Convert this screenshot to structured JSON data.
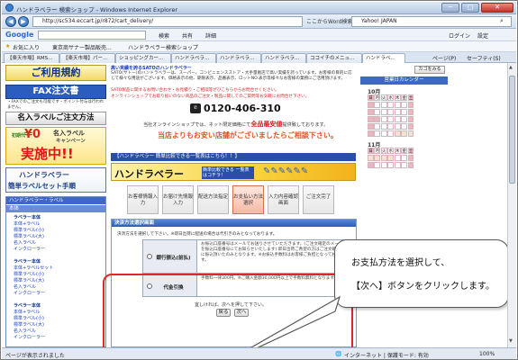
{
  "window": {
    "title": "ハンドラベラー 検索ショップ - Windows Internet Explorer",
    "minimize": "─",
    "maximize": "□",
    "close": "✕"
  },
  "addressbar": {
    "url": "http://sc534.eccart.jp/r872/cart_delivery/",
    "search_engine": "Yahoo! JAPAN",
    "search_value": "",
    "inline_text": "ここからWord検索"
  },
  "google_toolbar": {
    "logo": "Google",
    "items": [
      "検索",
      "共有",
      "詳細"
    ],
    "signin": "ログイン",
    "settings": "設定"
  },
  "favorites": {
    "label": "お気に入り",
    "items": [
      "東京商サナー製品販売...",
      "ハンドラベラー検索ショップ"
    ]
  },
  "tabs": {
    "items": [
      "【楽天市場】RMS...",
      "【楽天市場】パー...",
      "ショッピングカー...",
      "ハンドラベラ...",
      "ハンドラベラ...",
      "ハンドラベラ...",
      "ココイチのメニュ...",
      "ハンドラベ..."
    ],
    "commands": [
      "ページ(P)",
      "セーフティ(S)"
    ]
  },
  "left": {
    "banner_usage": "ご利用規約",
    "banner_fax": "FAX注文書",
    "fax_note": "・FAXでのご注文も可能です・ポイント付与は行われません。",
    "banner_name_title": "名入ラベルご注文方法",
    "campaign_small": "初期代",
    "campaign_price": "¥0",
    "campaign_label": "名入ラベル",
    "campaign_sub": "キャンペーン",
    "campaign_big": "実施中!!",
    "set_title": "ハンドラベラー",
    "set_sub": "簡単ラベルセット手順",
    "nav_head": "ハンドラベラー・ラベル",
    "nav_head2": "本体",
    "groups": [
      {
        "head": "ラベラー本体",
        "links": [
          "本体+ラベル",
          "標準ラベル(小)",
          "標準ラベル(大)",
          "名入ラベル",
          "インクローラー"
        ]
      },
      {
        "head": "ラベラー本体",
        "links": [
          "本体+ラベルセット",
          "標準ラベル(小)",
          "標準ラベル(大)",
          "名入ラベル",
          "インクローラー"
        ]
      },
      {
        "head": "ラベラー本体",
        "links": [
          "本体+ラベル",
          "標準ラベル(小)",
          "標準ラベル(大)",
          "名入ラベル",
          "インクローラー"
        ]
      }
    ]
  },
  "main": {
    "notice_title": "高い実績を誇るSATOのハンドラベラー",
    "notice_text": "SATO(サトー)のハンドラベラーは、スーパー、コンビニエンスストア・大手量販店で高い実績を誇っています。お客様の目的に応じて様々な用途がございます。価格表示の他、期限表示、品番表示、ロットNO.表示等様々なお客様の業務にご活用頂けます。",
    "notice_text2": "SATO製品に関するお問い合わせ・お見積り・ご相談等ぜひこちらからお問合せください。",
    "notice_online": "オンラインショップでお取り扱いのない商品のご注文・製品に関してのご質問等お気軽にお問合せ下さい。",
    "phone": "0120-406-310",
    "best_price_lead": "当社オンラインショップでは、ネット限定価格にて",
    "best_price": "全品最安値",
    "best_price_tail": "提供致しております。",
    "cheaper_shop": "当店よりもお安い店舗がございましたらご相談下さい。",
    "compare_bar": "【ハンドラベラー 簡単比較できる一覧表はこちら！！】",
    "compare_title": "ハンドラベラー",
    "compare_sub": "簡単比較できる 一覧表はコチラ！",
    "steps": [
      "お客様情報入力",
      "お届け先情報入力",
      "配送方法指定",
      "お支払い方法選択",
      "入力内容確認画面",
      "ご注文完了"
    ],
    "active_step": 3,
    "payment": {
      "head": "決済方法選択画面",
      "instruction": "決済方法を選択して下さい。※即日出荷に配送の場合は代引きのみとなっております。",
      "options": [
        {
          "label": "銀行振込(前払)",
          "desc": "お振込口座番号はメールでお送りさせていただきます。(ご注文確定のメールを振込口座番号にてお知らせいたします) 即日出荷ご希望の方はご注文確定後に振込頂いたのみとなります。※お振込手数料はお客様ご負担となっております。"
        },
        {
          "label": "代金引換",
          "desc": "手数料一律300円。※ご購入金額30,000円以上で手数料無料となります。"
        }
      ],
      "footer": "宜しければ、次へを押して下さい。",
      "back": "戻る",
      "next": "次へ"
    }
  },
  "right": {
    "search_btn": "カゴをみる",
    "calendar_title": "営業日カレンダー",
    "month1": "10月",
    "month2": "11月",
    "weekdays": [
      "日",
      "月",
      "火",
      "水",
      "木",
      "金",
      "土"
    ]
  },
  "callout": {
    "line1": "お支払方法を選択して、",
    "line2": "【次へ】ボタンをクリックします。"
  },
  "status": {
    "left": "ページが表示されました",
    "zone": "インターネット | 保護モード: 有効",
    "zoom": "100%"
  }
}
